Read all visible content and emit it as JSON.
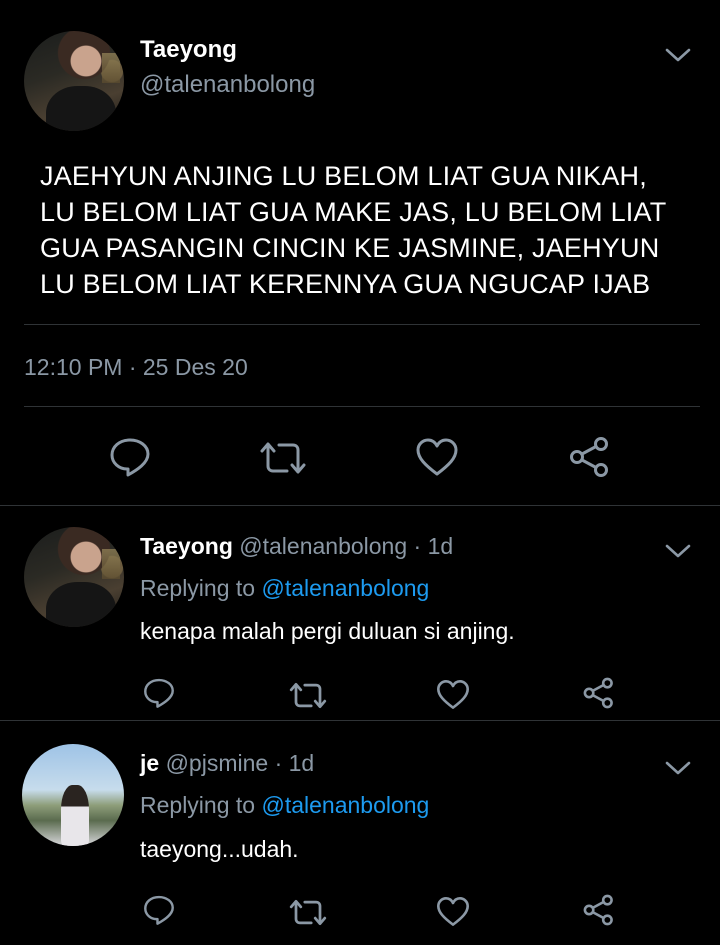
{
  "main_tweet": {
    "author_name": "Taeyong",
    "author_handle": "@talenanbolong",
    "text_lines": [
      "JAEHYUN ANJING LU BELOM LIAT GUA NIKAH,",
      "LU BELOM LIAT GUA MAKE JAS, LU BELOM LIAT",
      "GUA PASANGIN CINCIN KE JASMINE, JAEHYUN",
      "LU BELOM LIAT KERENNYA GUA NGUCAP IJAB"
    ],
    "timestamp": "12:10 PM · 25 Des 20"
  },
  "replies": [
    {
      "author_name": "Taeyong",
      "meta": "@talenanbolong · 1d",
      "replying_prefix": "Replying to ",
      "replying_to": "@talenanbolong",
      "text": "kenapa malah pergi duluan si anjing."
    },
    {
      "author_name": "je",
      "meta": "@pjsmine · 1d",
      "replying_prefix": "Replying to ",
      "replying_to": "@talenanbolong",
      "text": "taeyong...udah."
    }
  ],
  "icons": {
    "reply": "reply-icon",
    "retweet": "retweet-icon",
    "like": "heart-icon",
    "share": "share-icon",
    "more": "chevron-down-icon"
  },
  "colors": {
    "background": "#000000",
    "text": "#ffffff",
    "secondary": "#8b98a5",
    "link": "#1d9bf0",
    "divider": "#2f3336"
  }
}
